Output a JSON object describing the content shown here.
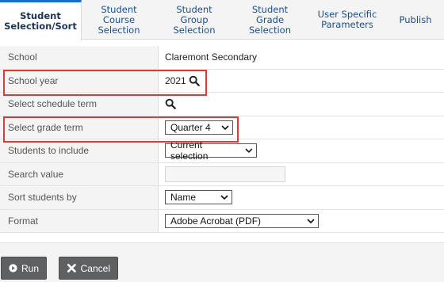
{
  "tabs": [
    {
      "label": "Student\nSelection/Sort",
      "active": true
    },
    {
      "label": "Student\nCourse\nSelection",
      "active": false
    },
    {
      "label": "Student\nGroup\nSelection",
      "active": false
    },
    {
      "label": "Student\nGrade\nSelection",
      "active": false
    },
    {
      "label": "User Specific\nParameters",
      "active": false
    },
    {
      "label": "Publish",
      "active": false
    }
  ],
  "form": {
    "school": {
      "label": "School",
      "value": "Claremont Secondary"
    },
    "school_year": {
      "label": "School year",
      "value": "2021"
    },
    "schedule_term": {
      "label": "Select schedule term"
    },
    "grade_term": {
      "label": "Select grade term",
      "value": "Quarter 4"
    },
    "students_to_include": {
      "label": "Students to include",
      "value": "Current selection"
    },
    "search_value": {
      "label": "Search value",
      "value": ""
    },
    "sort_students": {
      "label": "Sort students by",
      "value": "Name"
    },
    "format": {
      "label": "Format",
      "value": "Adobe Acrobat (PDF)"
    }
  },
  "footer": {
    "run_label": "Run",
    "cancel_label": "Cancel"
  },
  "colors": {
    "tab_text": "#1a4f8b",
    "active_tab_border": "#1a6ec8",
    "highlight": "#d93a3a",
    "button_bg": "#5f6062"
  }
}
